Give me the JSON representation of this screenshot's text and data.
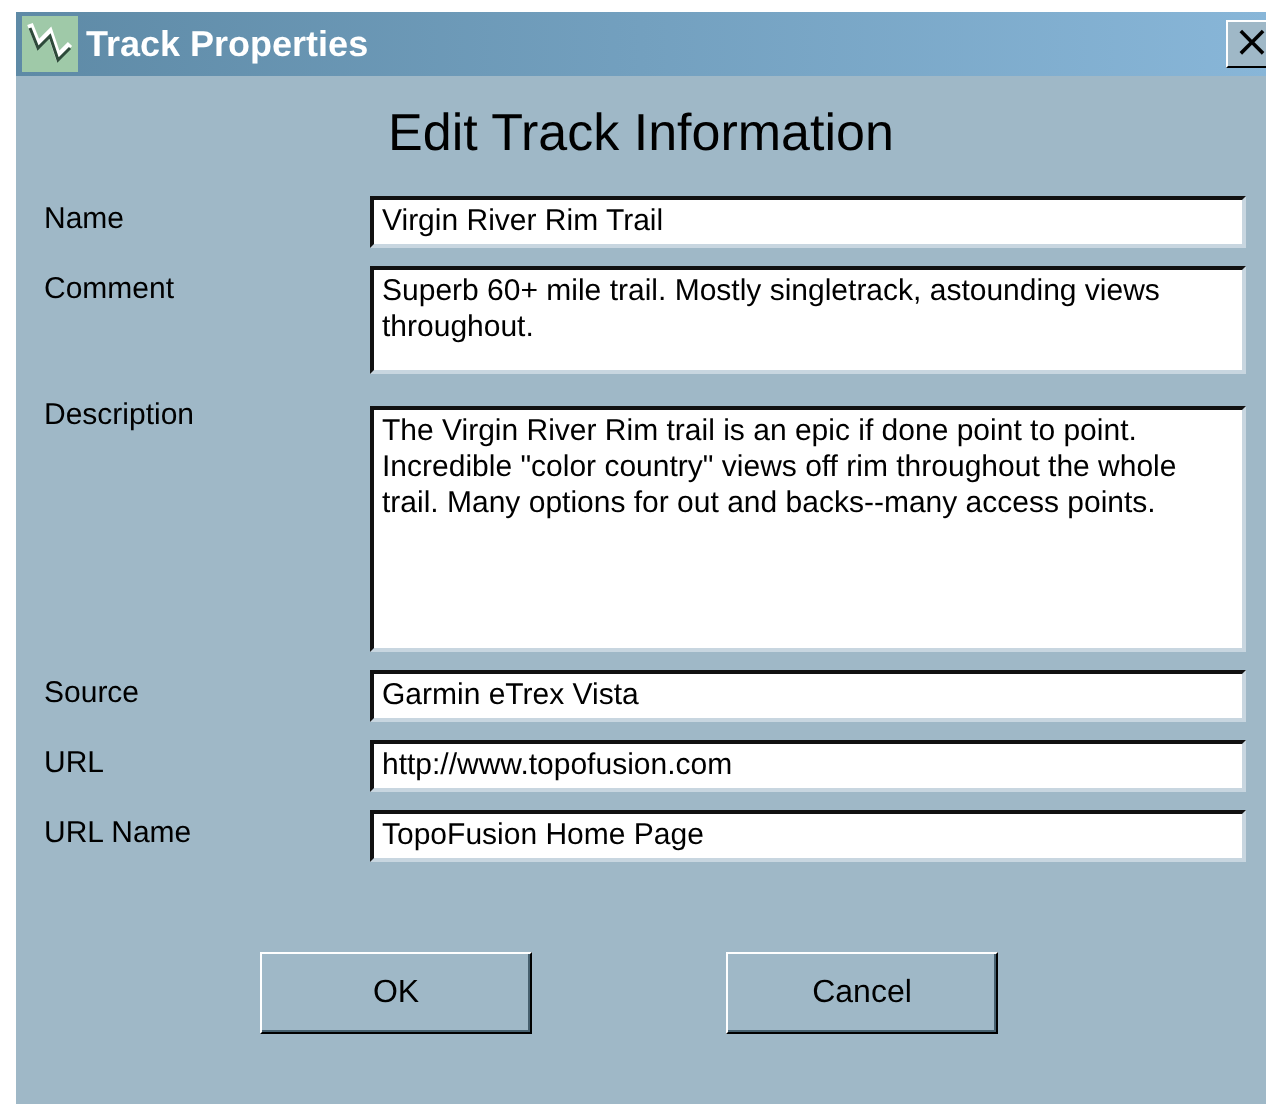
{
  "window": {
    "title": "Track Properties",
    "close": "×"
  },
  "heading": "Edit Track Information",
  "fields": [
    {
      "label": "Name",
      "kind": "line",
      "value": "Virgin River Rim Trail"
    },
    {
      "label": "Comment",
      "kind": "short",
      "value": "Superb 60+ mile trail.  Mostly singletrack, astounding views throughout."
    },
    {
      "label": "Description",
      "kind": "tall",
      "value": "The Virgin River Rim trail is an epic if done point to point.  Incredible \"color country\" views off rim throughout the whole trail.  Many options for out and backs--many access points."
    },
    {
      "label": "Source",
      "kind": "line",
      "value": "Garmin eTrex Vista"
    },
    {
      "label": "URL",
      "kind": "line",
      "value": "http://www.topofusion.com"
    },
    {
      "label": "URL Name",
      "kind": "line",
      "value": "TopoFusion Home Page"
    }
  ],
  "buttons": [
    "OK",
    "Cancel"
  ]
}
